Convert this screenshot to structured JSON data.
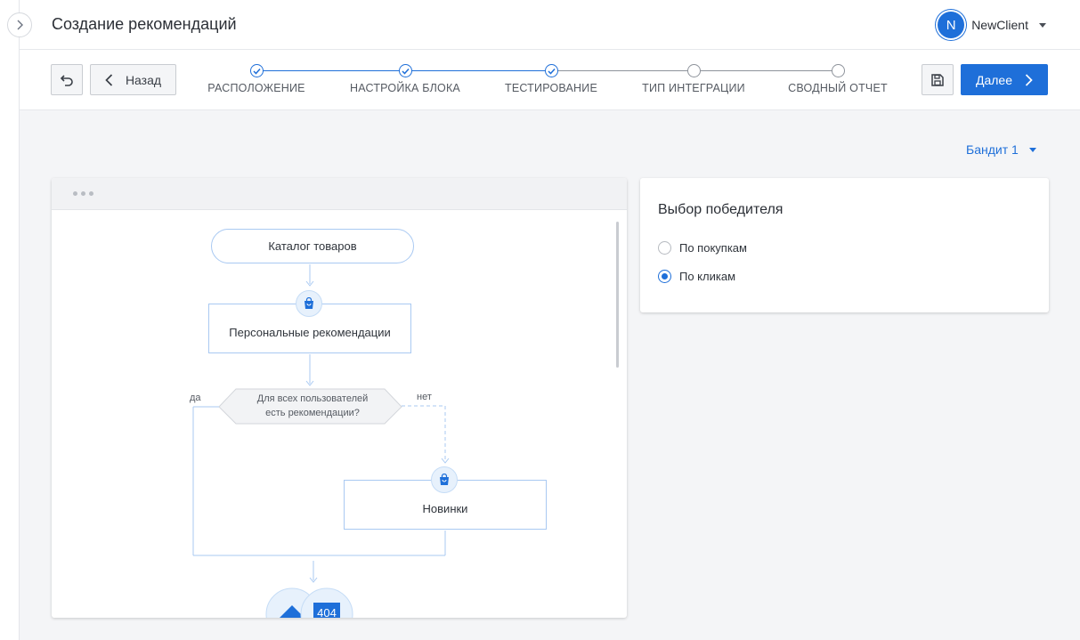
{
  "app": {
    "title": "Создание рекомендаций"
  },
  "user": {
    "initial": "N",
    "name": "NewClient"
  },
  "nav": {
    "back_label": "Назад",
    "next_label": "Далее"
  },
  "steps": [
    {
      "label": "РАСПОЛОЖЕНИЕ",
      "status": "done"
    },
    {
      "label": "НАСТРОЙКА БЛОКА",
      "status": "done"
    },
    {
      "label": "ТЕСТИРОВАНИЕ",
      "status": "done"
    },
    {
      "label": "ТИП ИНТЕГРАЦИИ",
      "status": "todo"
    },
    {
      "label": "СВОДНЫЙ ОТЧЕТ",
      "status": "todo"
    }
  ],
  "variant": {
    "selected": "Бандит 1"
  },
  "flow": {
    "catalog": "Каталог товаров",
    "personal": "Персональные рекомендации",
    "condition_line1": "Для всех пользователей",
    "condition_line2": "есть рекомендации?",
    "yes": "да",
    "no": "нет",
    "new_items": "Новинки",
    "error_label": "404"
  },
  "winner": {
    "title": "Выбор победителя",
    "options": [
      {
        "label": "По покупкам",
        "checked": false
      },
      {
        "label": "По кликам",
        "checked": true
      }
    ]
  },
  "colors": {
    "accent": "#1e6fd9",
    "node_border": "#a9c9f2",
    "badge_bg": "#e7f1fc"
  }
}
